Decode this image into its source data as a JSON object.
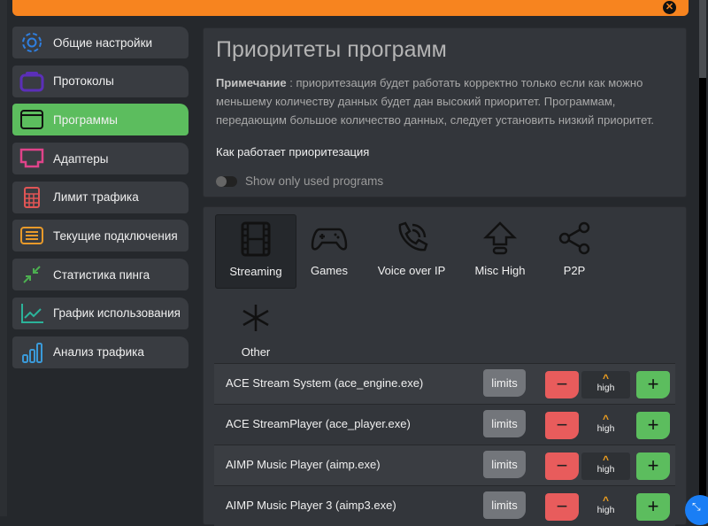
{
  "sidebar": {
    "items": [
      {
        "label": "Общие настройки",
        "icon": "gear-icon",
        "color": "#2f7fe0"
      },
      {
        "label": "Протоколы",
        "icon": "protocols-icon",
        "color": "#5b2fb8"
      },
      {
        "label": "Программы",
        "icon": "window-icon",
        "color": "#111111",
        "active": true
      },
      {
        "label": "Адаптеры",
        "icon": "ethernet-port-icon",
        "color": "#e0438a"
      },
      {
        "label": "Лимит трафика",
        "icon": "calculator-icon",
        "color": "#e05555"
      },
      {
        "label": "Текущие подключения",
        "icon": "list-icon",
        "color": "#e89a2a"
      },
      {
        "label": "Статистика пинга",
        "icon": "arrows-in-icon",
        "color": "#4caf50"
      },
      {
        "label": "График использования",
        "icon": "chart-line-icon",
        "color": "#2bb39a"
      },
      {
        "label": "Анализ трафика",
        "icon": "bar-chart-icon",
        "color": "#3a9ad9"
      }
    ]
  },
  "main": {
    "title": "Приоритеты программ",
    "note_label": "Примечание",
    "note_text": " : приоритезация будет работать корректно только если как можно меньшему количеству данных будет дан высокий приоритет. Программам, передающим большое количество данных, следует установить низкий приоритет.",
    "how_link": "Как работает приоритезация",
    "toggle_label": "Show only used programs",
    "toggle_on": false
  },
  "categories": [
    {
      "label": "Streaming",
      "icon": "film-icon",
      "selected": true
    },
    {
      "label": "Games",
      "icon": "gamepad-icon"
    },
    {
      "label": "Voice over IP",
      "icon": "phone-call-icon"
    },
    {
      "label": "Misc High",
      "icon": "arrow-up-icon"
    },
    {
      "label": "P2P",
      "icon": "share-icon"
    },
    {
      "label": "Other",
      "icon": "asterisk-icon"
    }
  ],
  "programs": [
    {
      "name": "ACE Stream System (ace_engine.exe)",
      "limits": "limits",
      "priority": "high"
    },
    {
      "name": "ACE StreamPlayer (ace_player.exe)",
      "limits": "limits",
      "priority": "high"
    },
    {
      "name": "AIMP Music Player (aimp.exe)",
      "limits": "limits",
      "priority": "high"
    },
    {
      "name": "AIMP Music Player 3 (aimp3.exe)",
      "limits": "limits",
      "priority": "high"
    }
  ],
  "colors": {
    "accent": "#f7841f",
    "active": "#5cbd5e",
    "minus": "#e85c5c",
    "priority": "#f3a21f"
  }
}
